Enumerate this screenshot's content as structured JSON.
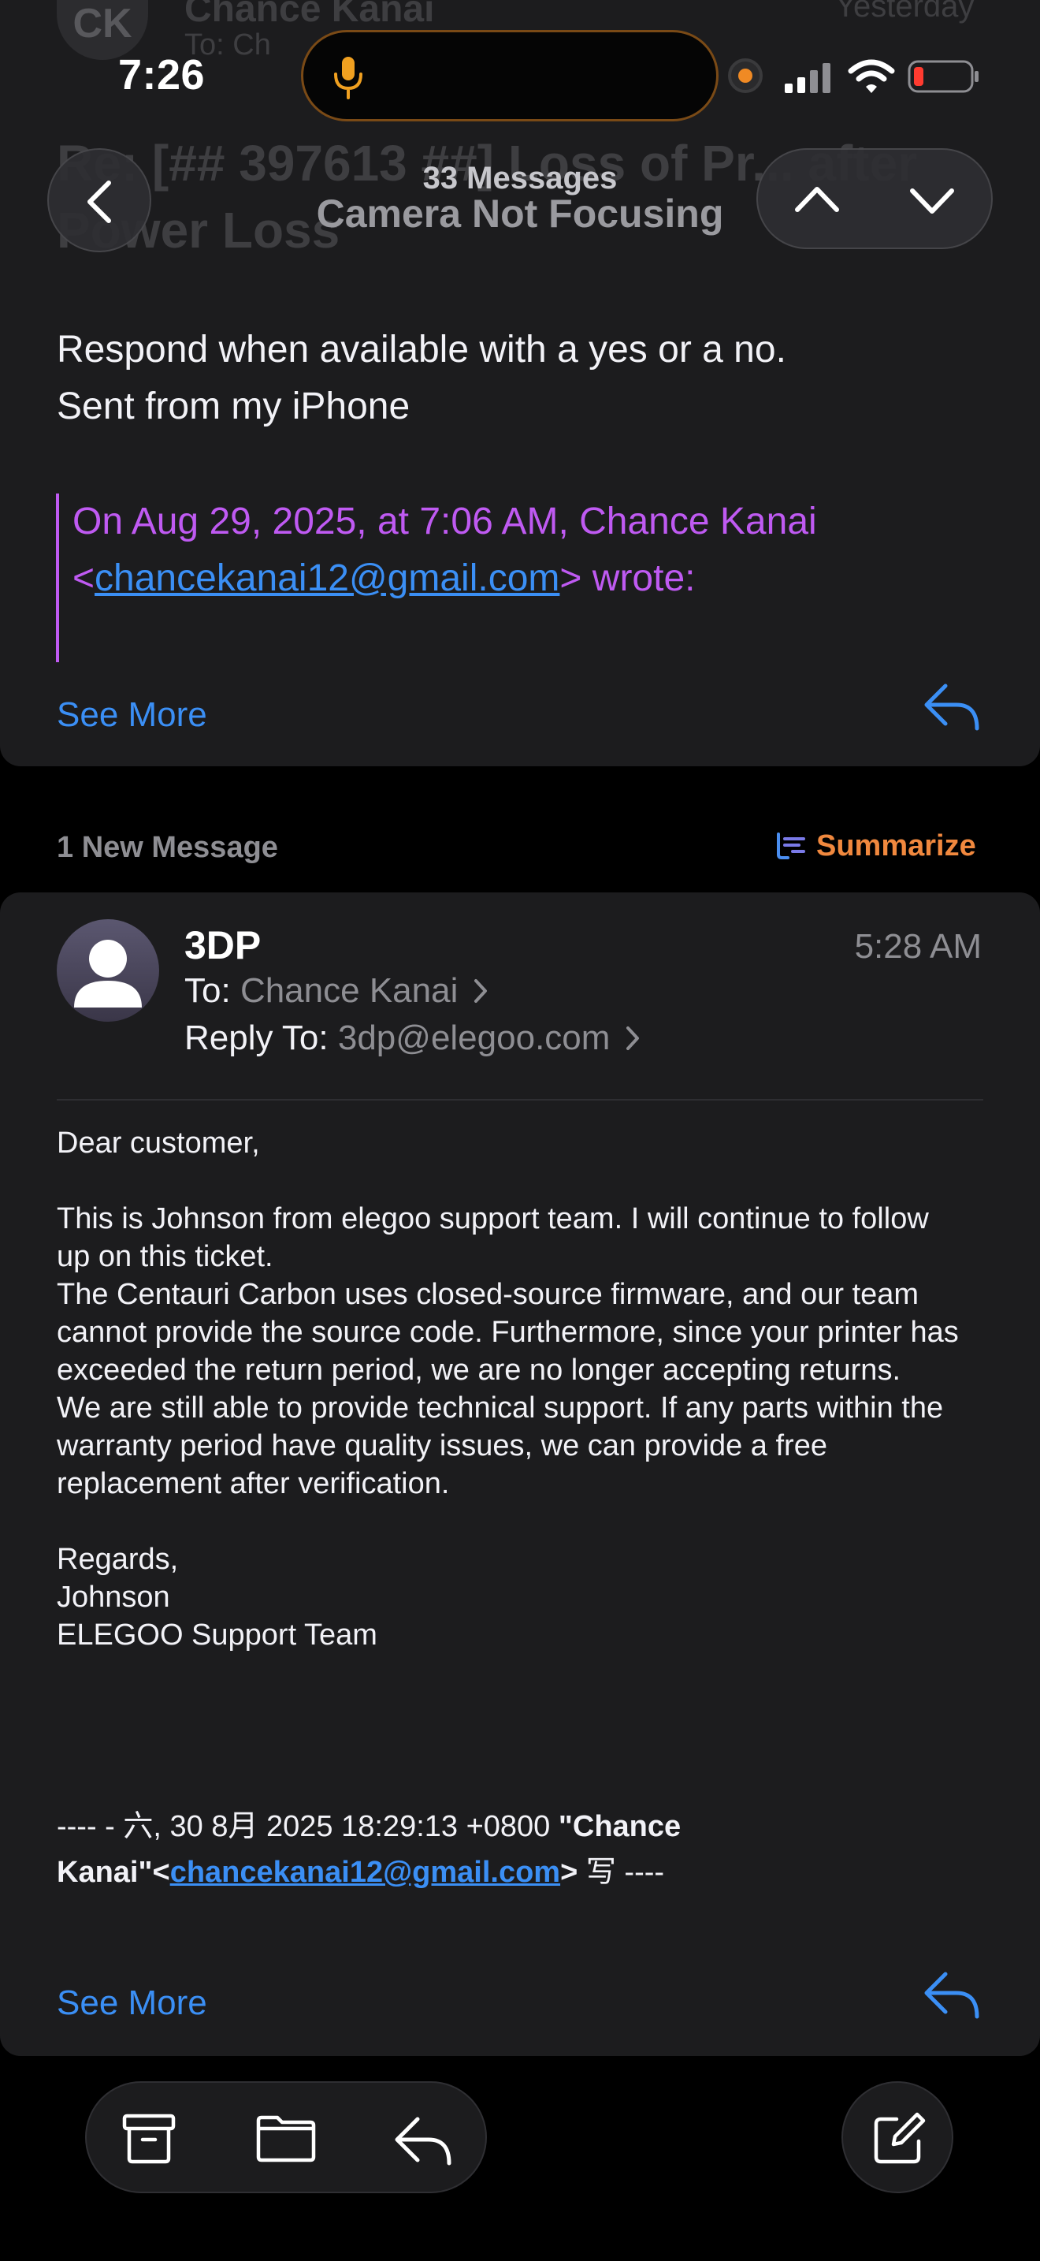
{
  "status_bar": {
    "time": "7:26"
  },
  "ghost_header": {
    "initials": "CK",
    "sender": "Chance Kanai",
    "recipient": "To: Ch",
    "date": "Yesterday",
    "subject_line1": "Re: [## 397613 ##] Loss of Pr... after",
    "subject_line2": "Power Loss"
  },
  "nav": {
    "message_count": "33 Messages",
    "thread_title": "Camera Not Focusing"
  },
  "message1": {
    "line1": "Respond when available with a yes or a no.",
    "line2": "Sent from my iPhone",
    "quote_prefix": "On Aug 29, 2025, at 7:06 AM, Chance Kanai",
    "quote_lt": "<",
    "quote_email": "chancekanai12@gmail.com",
    "quote_suffix": "> wrote:",
    "see_more": "See More"
  },
  "new_messages": {
    "label": "1 New Message",
    "summarize": "Summarize"
  },
  "message2": {
    "sender": "3DP",
    "time": "5:28 AM",
    "to_label": "To:",
    "to_value": "Chance Kanai",
    "reply_label": "Reply To:",
    "reply_value": "3dp@elegoo.com",
    "body": {
      "greeting": "Dear customer,",
      "p1_l1": "This is Johnson from elegoo support team. I will continue to follow",
      "p1_l2": "up on this ticket.",
      "p2_l1": "The Centauri Carbon uses closed-source firmware, and our team",
      "p2_l2": "cannot provide the source code. Furthermore, since your printer has",
      "p2_l3": "exceeded the return period, we are no longer accepting returns.",
      "p3_l1": "We are still able to provide technical support. If any parts within the",
      "p3_l2": "warranty period have quality issues, we can provide a free",
      "p3_l3": "replacement after verification.",
      "regards": "Regards,",
      "name": "Johnson",
      "team": "ELEGOO Support Team"
    },
    "quote_header_l1_plain": "---- - 六, 30 8月 2025 18:29:13 +0800 ",
    "quote_header_l1_bold": "\"Chance",
    "quote_header_l2_bold_a": "Kanai\"<",
    "quote_header_email": "chancekanai12@gmail.com",
    "quote_header_l2_bold_b": ">",
    "quote_header_l2_plain": " 写 ----",
    "see_more": "See More"
  },
  "colors": {
    "accent_blue": "#3b8ff5",
    "quote_purple": "#bf5af2",
    "card_bg": "#1c1c1e",
    "summarize_orange": "#f0883e"
  }
}
